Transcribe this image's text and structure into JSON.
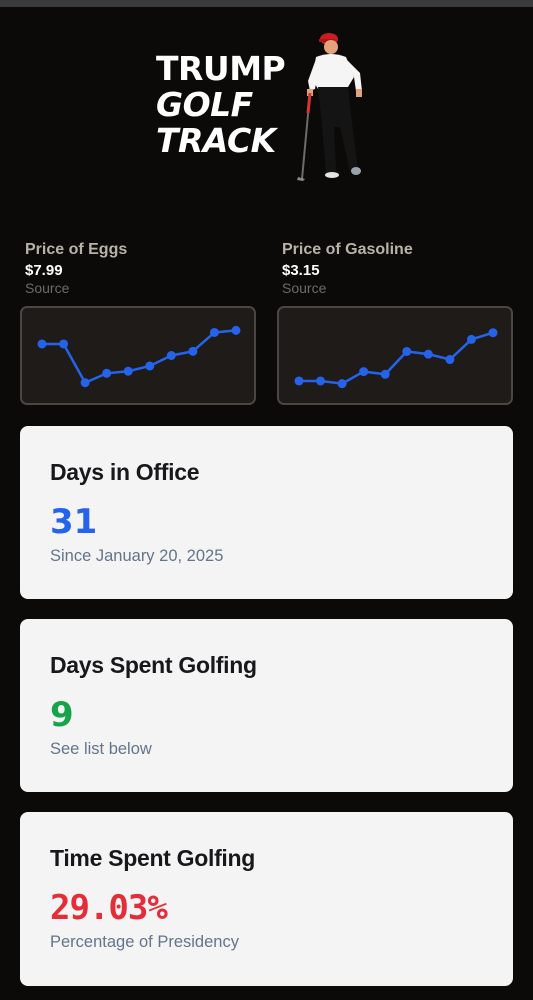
{
  "hero": {
    "title_line1": "TRUMP",
    "title_line2": "GOLF",
    "title_line3": "TRACK"
  },
  "eggs": {
    "label": "Price of Eggs",
    "value": "$7.99",
    "source": "Source",
    "chart_data": {
      "type": "line",
      "values": [
        4.15,
        4.15,
        2.3,
        2.75,
        2.85,
        3.1,
        3.6,
        3.8,
        4.7,
        4.8
      ],
      "ylim": [
        2.0,
        5.2
      ],
      "color": "#2563eb"
    }
  },
  "gas": {
    "label": "Price of Gasoline",
    "value": "$3.15",
    "source": "Source",
    "chart_data": {
      "type": "line",
      "values": [
        3.0,
        3.0,
        2.9,
        3.35,
        3.25,
        4.1,
        4.0,
        3.8,
        4.55,
        4.8
      ],
      "ylim": [
        2.7,
        5.2
      ],
      "color": "#2563eb"
    }
  },
  "cards": [
    {
      "title": "Days in Office",
      "value": "31",
      "sub": "Since January 20, 2025",
      "color": "#2563eb"
    },
    {
      "title": "Days Spent Golfing",
      "value": "9",
      "sub": "See list below",
      "color": "#16a34a"
    },
    {
      "title": "Time Spent Golfing",
      "value": "29.03%",
      "sub": "Percentage of Presidency",
      "color": "#e52d3a"
    }
  ]
}
